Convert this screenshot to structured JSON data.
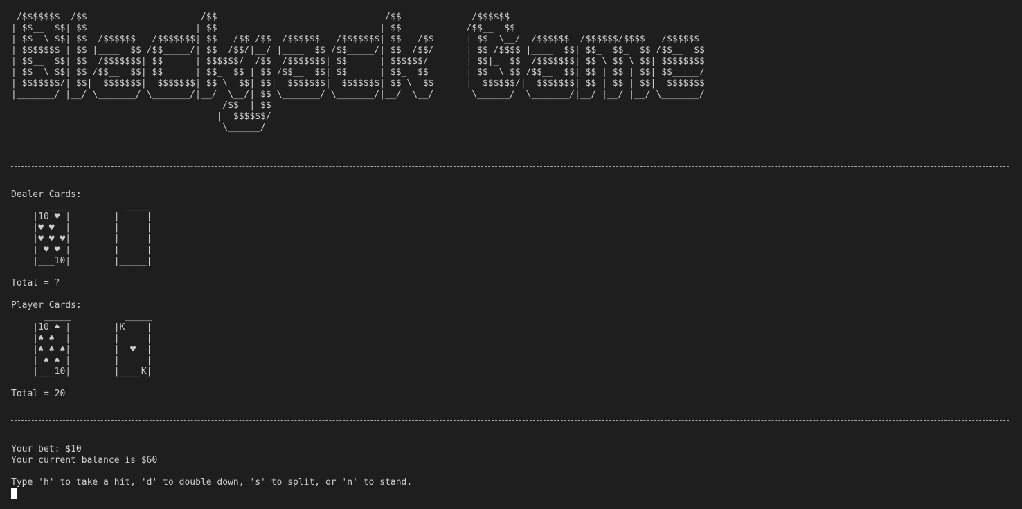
{
  "banner_ascii": " /$$$$$$$  /$$                     /$$                               /$$             /$$$$$$\n| $$__  $$| $$                    | $$                              | $$            /$$__  $$\n| $$  \\ $$| $$  /$$$$$$   /$$$$$$$| $$   /$$ /$$  /$$$$$$   /$$$$$$$| $$   /$$      | $$  \\__/  /$$$$$$  /$$$$$$/$$$$   /$$$$$$\n| $$$$$$$ | $$ |____  $$ /$$_____/| $$  /$$/|__/ |____  $$ /$$_____/| $$  /$$/      | $$ /$$$$ |____  $$| $$_  $$_  $$ /$$__  $$\n| $$__  $$| $$  /$$$$$$$| $$      | $$$$$$/  /$$  /$$$$$$$| $$      | $$$$$$/       | $$|_  $$  /$$$$$$$| $$ \\ $$ \\ $$| $$$$$$$$\n| $$  \\ $$| $$ /$$__  $$| $$      | $$_  $$ | $$ /$$__  $$| $$      | $$_  $$       | $$  \\ $$ /$$__  $$| $$ | $$ | $$| $$_____/\n| $$$$$$$/| $$|  $$$$$$$|  $$$$$$$| $$ \\  $$| $$|  $$$$$$$|  $$$$$$$| $$ \\  $$      |  $$$$$$/|  $$$$$$$| $$ | $$ | $$|  $$$$$$$\n|_______/ |__/ \\_______/ \\_______/|__/  \\__/| $$ \\_______/ \\_______/|__/  \\__/       \\______/  \\_______/|__/ |__/ |__/ \\_______/\n                                       /$$  | $$\n                                      |  $$$$$$/\n                                       \\______/",
  "separator_top": "",
  "dealer": {
    "label": "Dealer Cards:",
    "cards_ascii": "      _____          _____\n    |10 ♥ |        |     |\n    |♥ ♥  |        |     |\n    |♥ ♥ ♥|        |     |\n    | ♥ ♥ |        |     |\n    |___10|        |_____|",
    "total": "Total = ?"
  },
  "player": {
    "label": "Player Cards:",
    "cards_ascii": "      _____          _____\n    |10 ♠ |        |K    |\n    |♠ ♠  |        |     |\n    |♠ ♠ ♠|        |  ♥  |\n    | ♠ ♠ |        |     |\n    |___10|        |____K|",
    "total": "Total = 20"
  },
  "status": {
    "bet": "Your bet: $10",
    "balance": "Your current balance is $60"
  },
  "prompt": "Type 'h' to take a hit, 'd' to double down, 's' to split, or 'n' to stand.",
  "colors": {
    "background": "#1e1e1e",
    "text": "#cccccc",
    "cursor": "#ffffff"
  }
}
